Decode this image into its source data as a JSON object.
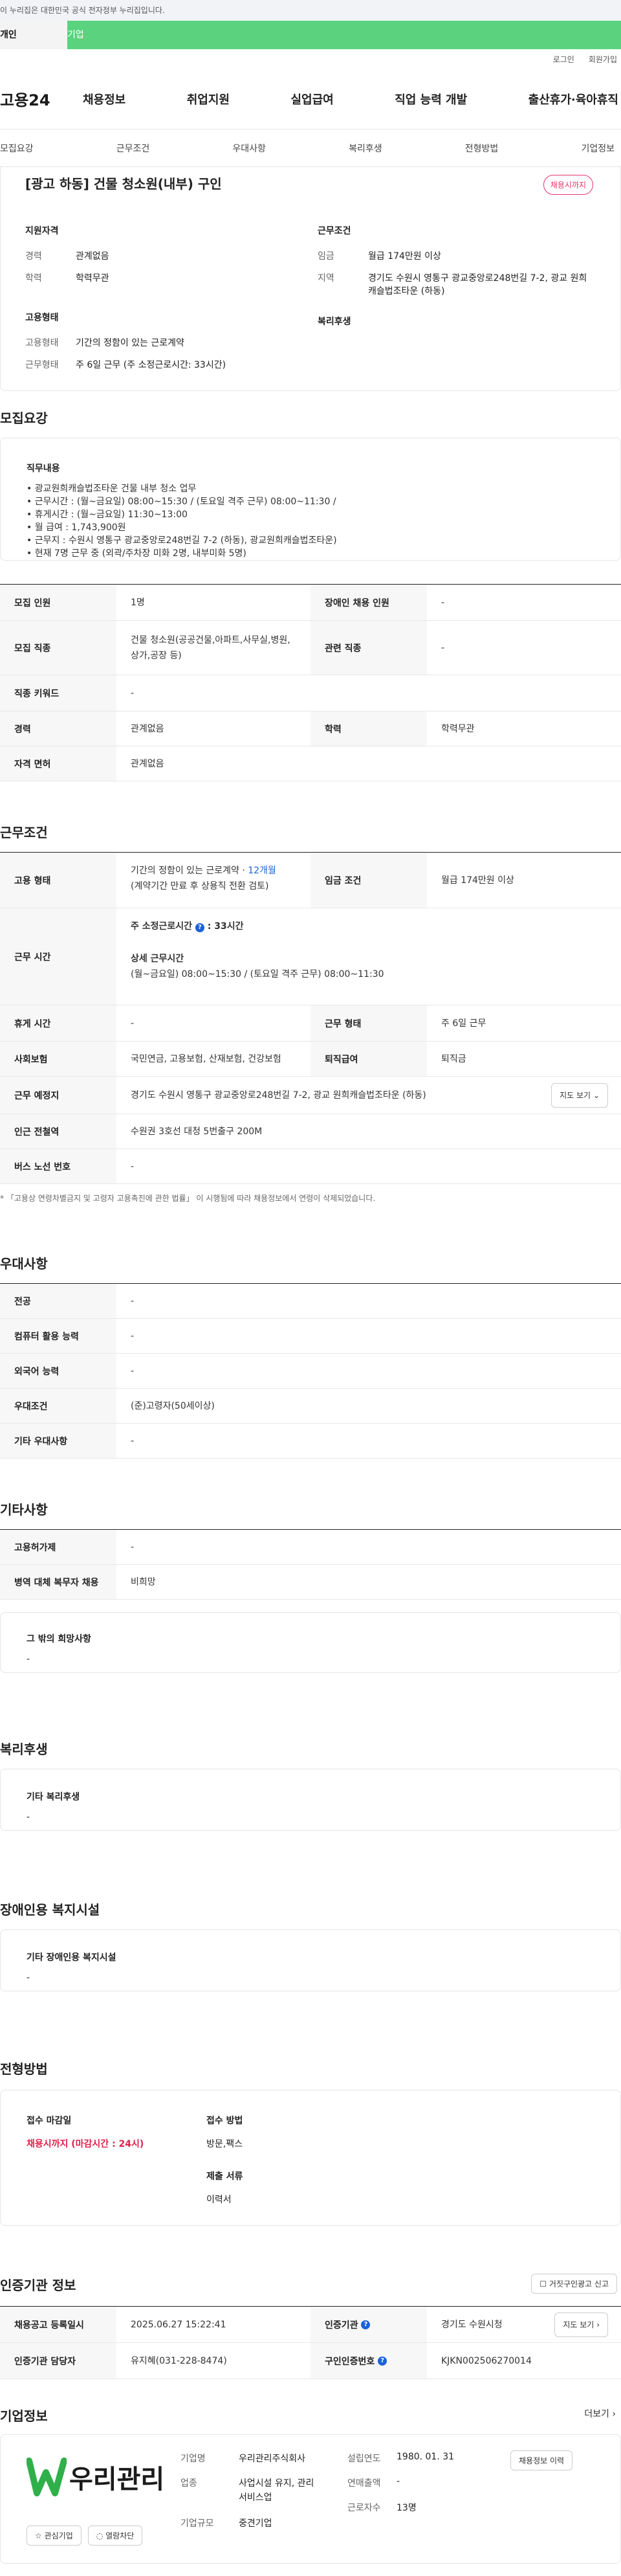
{
  "gov_notice": "이 누리집은 대한민국 공식 전자정부 누리집입니다.",
  "type_tabs": {
    "individual": "개인",
    "corporate": "기업"
  },
  "util": {
    "login": "로그인",
    "signup": "회원가입"
  },
  "logo": "고용24",
  "gnb": [
    "채용정보",
    "취업지원",
    "실업급여",
    "직업 능력 개발",
    "출산휴가·육아휴직"
  ],
  "subtabs": [
    "모집요강",
    "근무조건",
    "우대사항",
    "복리후생",
    "전형방법",
    "기업정보"
  ],
  "summary": {
    "title": "[광고 하동] 건물 청소원(내부) 구인",
    "badge": "채용시까지",
    "qual_h": "지원자격",
    "career_k": "경력",
    "career_v": "관계없음",
    "edu_k": "학력",
    "edu_v": "학력무관",
    "cond_h": "근무조건",
    "wage_k": "임금",
    "wage_v": "월급 174만원 이상",
    "region_k": "지역",
    "region_v": "경기도 수원시 영통구 광교중앙로248번길 7-2, 광교 원희캐슬법조타운 (하동)",
    "emp_h": "고용형태",
    "emptype_k": "고용형태",
    "emptype_v": "기간의 정함이 있는 근로계약",
    "shift_k": "근무형태",
    "shift_v": "주 6일 근무 (주 소정근로시간: 33시간)",
    "welfare_h": "복리후생"
  },
  "recruit": {
    "title": "모집요강",
    "duty_h": "직무내용",
    "duty_lines": [
      "• 광교원희캐슬법조타운 건물 내부 청소 업무",
      "• 근무시간 : (월~금요일) 08:00~15:30 / (토요일 격주 근무)  08:00~11:30 /",
      "• 휴게시간 : (월~금요일) 11:30~13:00",
      "• 월 급여 : 1,743,900원",
      "• 근무지 :  수원시 영통구 광교중앙로248번길 7-2 (하동), 광교원희캐슬법조타운)",
      "• 현재 7명 근무 중 (외곽/주차장 미화 2명, 내부미화 5명)"
    ],
    "rows": [
      {
        "k1": "모집 인원",
        "v1": "1명",
        "k2": "장애인 채용 인원",
        "v2": "-"
      },
      {
        "k1": "모집 직종",
        "v1": "건물 청소원(공공건물,아파트,사무실,병원,상가,공장 등)",
        "k2": "관련 직종",
        "v2": "-"
      },
      {
        "k1": "직종 키워드",
        "v1": "-"
      },
      {
        "k1": "경력",
        "v1": "관계없음",
        "k2": "학력",
        "v2": "학력무관"
      },
      {
        "k1": "자격 면허",
        "v1": "관계없음"
      }
    ]
  },
  "work": {
    "title": "근무조건",
    "emp_k": "고용 형태",
    "emp_v1": "기간의 정함이 있는 근로계약 · ",
    "emp_v1b": "12개월",
    "emp_v2": "(계약기간 만료 후 상용직 전환 검토)",
    "wage_k": "임금 조건",
    "wage_v": "월급 174만원 이상",
    "time_k": "근무 시간",
    "time_h1": "주 소정근로시간",
    "time_h1v": ": 33시간",
    "time_h2": "상세 근무시간",
    "time_v2": "(월~금요일) 08:00~15:30 / (토요일 격주 근무)  08:00~11:30",
    "rows": [
      {
        "k1": "휴게 시간",
        "v1": "-",
        "k2": "근무 형태",
        "v2": "주 6일 근무"
      },
      {
        "k1": "사회보험",
        "v1": "국민연금, 고용보험, 산재보험, 건강보험",
        "k2": "퇴직급여",
        "v2": "퇴직금"
      }
    ],
    "place_k": "근무 예정지",
    "place_v": "경기도 수원시 영통구 광교중앙로248번길 7-2, 광교 원희캐슬법조타운 (하동)",
    "map_btn": "지도 보기",
    "station_k": "인근 전철역",
    "station_v": "수원권 3호선 대청 5번출구 200M",
    "bus_k": "버스 노선 번호",
    "bus_v": "-",
    "note": "* 「고용상 연령차별금지 및 고령자 고용촉진에 관한 법률」 이 시행됨에 따라 채용정보에서 연령이 삭제되었습니다."
  },
  "pref": {
    "title": "우대사항",
    "rows": [
      {
        "k": "전공",
        "v": "-"
      },
      {
        "k": "컴퓨터 활용 능력",
        "v": "-"
      },
      {
        "k": "외국어 능력",
        "v": "-"
      },
      {
        "k": "우대조건",
        "v": "(준)고령자(50세이상)"
      },
      {
        "k": "기타 우대사항",
        "v": "-"
      }
    ]
  },
  "etc": {
    "title": "기타사항",
    "rows": [
      {
        "k": "고용허가제",
        "v": "-"
      },
      {
        "k": "병역 대체 복무자 채용",
        "v": "비희망"
      }
    ],
    "other_h": "그 밖의 희망사항",
    "other_v": "-"
  },
  "welfare": {
    "title": "복리후생",
    "box_h": "기타 복리후생",
    "box_v": "-"
  },
  "disab": {
    "title": "장애인용 복지시설",
    "box_h": "기타 장애인용 복지시설",
    "box_v": "-"
  },
  "process": {
    "title": "전형방법",
    "deadline_h": "접수 마감일",
    "deadline_v": "채용시까지 (마감시간 : 24시)",
    "method_h": "접수 방법",
    "method_v": "방문,팩스",
    "docs_h": "제출 서류",
    "docs_v": "이력서"
  },
  "agency": {
    "title": "인증기관 정보",
    "report_btn": "거짓구인광고 신고",
    "reg_k": "채용공고 등록일시",
    "reg_v": "2025.06.27 15:22:41",
    "org_k": "인증기관",
    "org_v": "경기도 수원시청",
    "map_btn": "지도 보기",
    "mgr_k": "인증기관 담당자",
    "mgr_v": "유지혜(031-228-8474)",
    "no_k": "구인인증번호",
    "no_v": "KJKN002506270014"
  },
  "company": {
    "title": "기업정보",
    "more": "더보기",
    "logo_text": "우리관리",
    "fav_btn": "관심기업",
    "block_btn": "열람차단",
    "name_k": "기업명",
    "name_v": "우리관리주식회사",
    "biz_k": "업종",
    "biz_v": "사업시설 유지, 관리 서비스업",
    "size_k": "기업규모",
    "size_v": "중견기업",
    "est_k": "설립연도",
    "est_v": "1980. 01. 31",
    "sales_k": "연매출액",
    "sales_v": "-",
    "emp_k": "근로자수",
    "emp_v": "13명",
    "history_btn": "채용정보 이력"
  }
}
